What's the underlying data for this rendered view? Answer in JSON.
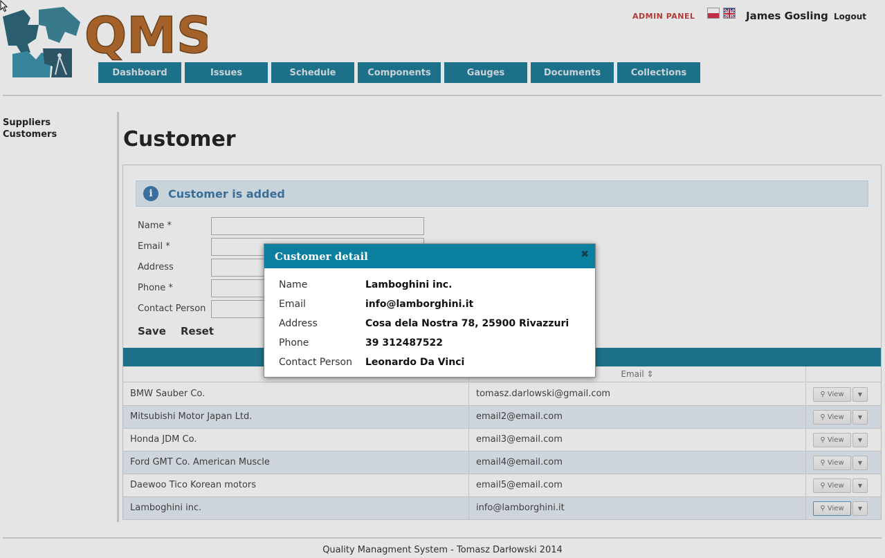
{
  "header": {
    "logo_text": "QMS",
    "admin_panel": "ADMIN PANEL",
    "user_name": "James Gosling",
    "logout": "Logout",
    "nav": [
      "Dashboard",
      "Issues",
      "Schedule",
      "Components",
      "Gauges",
      "Documents",
      "Collections"
    ]
  },
  "sidebar": {
    "items": [
      "Suppliers",
      "Customers"
    ]
  },
  "main": {
    "title": "Customer",
    "alert": "Customer is added",
    "form": {
      "name_label": "Name *",
      "email_label": "Email *",
      "address_label": "Address",
      "phone_label": "Phone *",
      "contact_label": "Contact Person",
      "save": "Save",
      "reset": "Reset"
    },
    "table": {
      "email_header": "Email",
      "view_label": "View",
      "rows": [
        {
          "name": "BMW Sauber Co.",
          "email": "tomasz.darlowski@gmail.com"
        },
        {
          "name": "Mitsubishi Motor Japan Ltd.",
          "email": "email2@email.com"
        },
        {
          "name": "Honda JDM Co.",
          "email": "email3@email.com"
        },
        {
          "name": "Ford GMT Co. American Muscle",
          "email": "email4@email.com"
        },
        {
          "name": "Daewoo Tico Korean motors",
          "email": "email5@email.com"
        },
        {
          "name": "Lamboghini inc.",
          "email": "info@lamborghini.it"
        }
      ]
    }
  },
  "modal": {
    "title": "Customer detail",
    "labels": [
      "Name",
      "Email",
      "Address",
      "Phone",
      "Contact Person"
    ],
    "values": [
      "Lamboghini inc.",
      "info@lamborghini.it",
      "Cosa dela Nostra 78, 25900 Rivazzuri",
      "39 312487522",
      "Leonardo Da Vinci"
    ]
  },
  "footer": "Quality Managment System - Tomasz Darłowski 2014",
  "colors": {
    "accent": "#0c7190",
    "modal_header": "#0a7fa0",
    "alert_bg": "#dce9f2",
    "admin_red": "#c0302a",
    "logo_orange": "#b0601c"
  }
}
